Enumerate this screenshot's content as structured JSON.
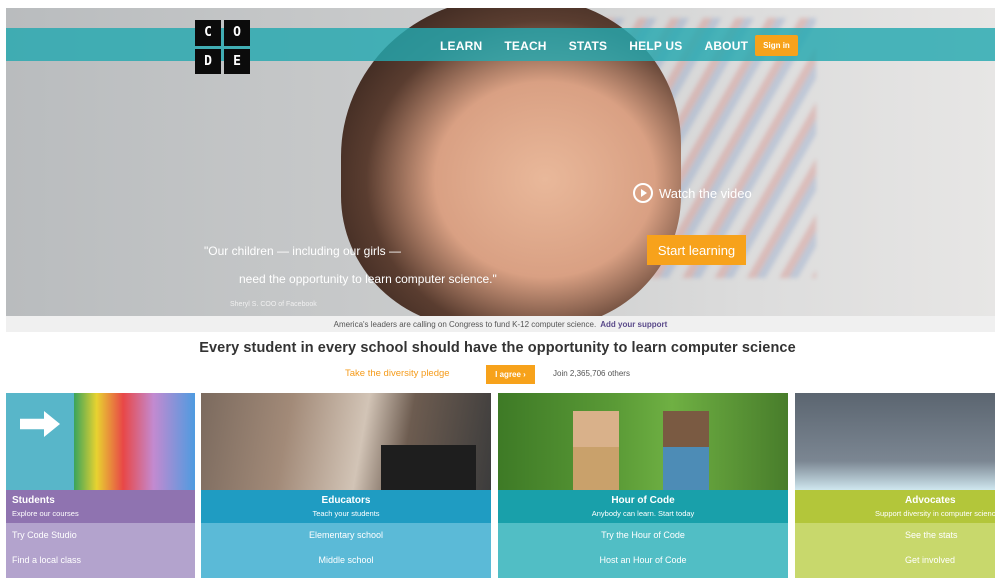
{
  "logo": {
    "letters": [
      "C",
      "O",
      "D",
      "E"
    ]
  },
  "nav": {
    "links": [
      "LEARN",
      "TEACH",
      "STATS",
      "HELP US",
      "ABOUT"
    ],
    "signin_label": "Sign in"
  },
  "hero": {
    "watch_label": "Watch the video",
    "start_label": "Start learning",
    "quote_line1": "\"Our children — including our girls —",
    "quote_line2": "need the opportunity to learn computer science.\"",
    "attribution": "Sheryl S. COO of Facebook"
  },
  "announcement": {
    "text": "America's leaders are calling on Congress to fund K-12 computer science.",
    "link": "Add your support"
  },
  "headline": "Every student in every school should have the opportunity to learn computer science",
  "pledge": {
    "text": "Take the diversity pledge",
    "button": "I agree ›",
    "join_text": "Join 2,365,706 others"
  },
  "tiles": [
    {
      "title": "Students",
      "subtitle": "Explore our courses",
      "links": [
        "Try Code Studio",
        "Find a local class"
      ]
    },
    {
      "title": "Educators",
      "subtitle": "Teach your students",
      "links": [
        "Elementary school",
        "Middle school"
      ]
    },
    {
      "title": "Hour of Code",
      "subtitle": "Anybody can learn. Start today",
      "links": [
        "Try the Hour of Code",
        "Host an Hour of Code"
      ]
    },
    {
      "title": "Advocates",
      "subtitle": "Support diversity in computer science",
      "links": [
        "See the stats",
        "Get involved"
      ]
    }
  ],
  "colors": {
    "teal_nav": "#24a8b0",
    "orange": "#f7a21b",
    "students": "#8f73b0",
    "educators": "#1f9cc2",
    "hour_of_code": "#19a0aa",
    "advocates": "#b3c63a"
  }
}
